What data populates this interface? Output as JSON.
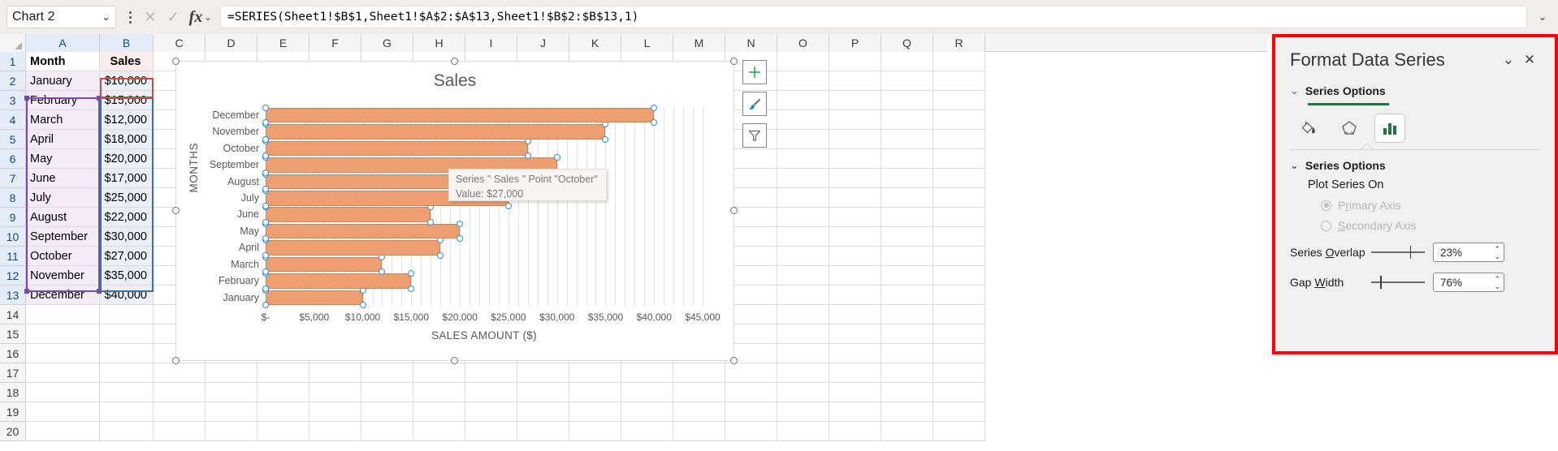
{
  "formula_bar": {
    "name_box_value": "Chart 2",
    "name_box_caret": "⌄",
    "kebab_name": "more-options",
    "cancel_icon": "✕",
    "confirm_icon": "✓",
    "fx_label": "fx",
    "fx_caret": "⌄",
    "formula": "=SERIES(Sheet1!$B$1,Sheet1!$A$2:$A$13,Sheet1!$B$2:$B$13,1)",
    "expand_icon": "⌄"
  },
  "grid": {
    "columns": [
      "A",
      "B",
      "C",
      "D",
      "E",
      "F",
      "G",
      "H",
      "I",
      "J",
      "K",
      "L",
      "M",
      "N",
      "O",
      "P",
      "Q",
      "R"
    ],
    "rows": [
      "1",
      "2",
      "3",
      "4",
      "5",
      "6",
      "7",
      "8",
      "9",
      "10",
      "11",
      "12",
      "13",
      "14",
      "15",
      "16",
      "17",
      "18",
      "19",
      "20"
    ],
    "data": [
      {
        "a": "Month",
        "b": "Sales"
      },
      {
        "a": "January",
        "b": "$10,000"
      },
      {
        "a": "February",
        "b": "$15,000"
      },
      {
        "a": "March",
        "b": "$12,000"
      },
      {
        "a": "April",
        "b": "$18,000"
      },
      {
        "a": "May",
        "b": "$20,000"
      },
      {
        "a": "June",
        "b": "$17,000"
      },
      {
        "a": "July",
        "b": "$25,000"
      },
      {
        "a": "August",
        "b": "$22,000"
      },
      {
        "a": "September",
        "b": "$30,000"
      },
      {
        "a": "October",
        "b": "$27,000"
      },
      {
        "a": "November",
        "b": "$35,000"
      },
      {
        "a": "December",
        "b": "$40,000"
      },
      {
        "a": "",
        "b": ""
      },
      {
        "a": "",
        "b": ""
      },
      {
        "a": "",
        "b": ""
      },
      {
        "a": "",
        "b": ""
      },
      {
        "a": "",
        "b": ""
      },
      {
        "a": "",
        "b": ""
      },
      {
        "a": "",
        "b": ""
      }
    ],
    "highlight_colors": {
      "category_range": "#7b49ab",
      "value_range": "#2e75b6",
      "series_name": "#c0504d"
    }
  },
  "chart": {
    "title": "Sales",
    "y_axis_title": "MONTHS",
    "x_axis_title": "SALES AMOUNT ($)",
    "bar_color": "#ed9f72",
    "tooltip": {
      "line1": "Series \" Sales \" Point \"October\"",
      "line2": "Value:  $27,000"
    },
    "buttons": [
      {
        "name": "chart-elements-button",
        "icon": "plus-icon"
      },
      {
        "name": "chart-styles-button",
        "icon": "paintbrush-icon"
      },
      {
        "name": "chart-filters-button",
        "icon": "funnel-icon"
      }
    ]
  },
  "chart_data": {
    "type": "bar",
    "orientation": "horizontal",
    "title": "Sales",
    "xlabel": "SALES AMOUNT ($)",
    "ylabel": "MONTHS",
    "categories": [
      "January",
      "February",
      "March",
      "April",
      "May",
      "June",
      "July",
      "August",
      "September",
      "October",
      "November",
      "December"
    ],
    "values": [
      10000,
      15000,
      12000,
      18000,
      20000,
      17000,
      25000,
      22000,
      30000,
      27000,
      35000,
      40000
    ],
    "series": [
      {
        "name": "Sales",
        "values": [
          10000,
          15000,
          12000,
          18000,
          20000,
          17000,
          25000,
          22000,
          30000,
          27000,
          35000,
          40000
        ]
      }
    ],
    "xlim": [
      0,
      45000
    ],
    "xticks": [
      "$-",
      "$5,000",
      "$10,000",
      "$15,000",
      "$20,000",
      "$25,000",
      "$30,000",
      "$35,000",
      "$40,000",
      "$45,000"
    ],
    "xtick_values": [
      0,
      5000,
      10000,
      15000,
      20000,
      25000,
      30000,
      35000,
      40000,
      45000
    ],
    "grid": true,
    "legend": false
  },
  "pane": {
    "title": "Format Data Series",
    "collapse_icon": "⌄",
    "close_icon": "✕",
    "section_header": "Series Options",
    "tabs": [
      {
        "name": "fill-and-line-tab",
        "icon": "paint-bucket-icon",
        "active": false
      },
      {
        "name": "effects-tab",
        "icon": "pentagon-icon",
        "active": false
      },
      {
        "name": "series-options-tab",
        "icon": "bar-chart-icon",
        "active": true
      }
    ],
    "accent_color": "#217346",
    "series_options_label": "Series Options",
    "plot_series_on_label": "Plot Series On",
    "radios": [
      {
        "label_pre": "P",
        "label_accel": "r",
        "label_post": "imary Axis",
        "selected": true
      },
      {
        "label_pre": "",
        "label_accel": "S",
        "label_post": "econdary Axis",
        "selected": false
      }
    ],
    "sliders": [
      {
        "label_pre": "Series ",
        "label_accel": "O",
        "label_post": "verlap",
        "value": "23%",
        "thumb_pct": 72
      },
      {
        "label_pre": "Gap ",
        "label_accel": "W",
        "label_post": "idth",
        "value": "76%",
        "thumb_pct": 17
      }
    ],
    "spin_up": "⌃",
    "spin_down": "⌄"
  }
}
